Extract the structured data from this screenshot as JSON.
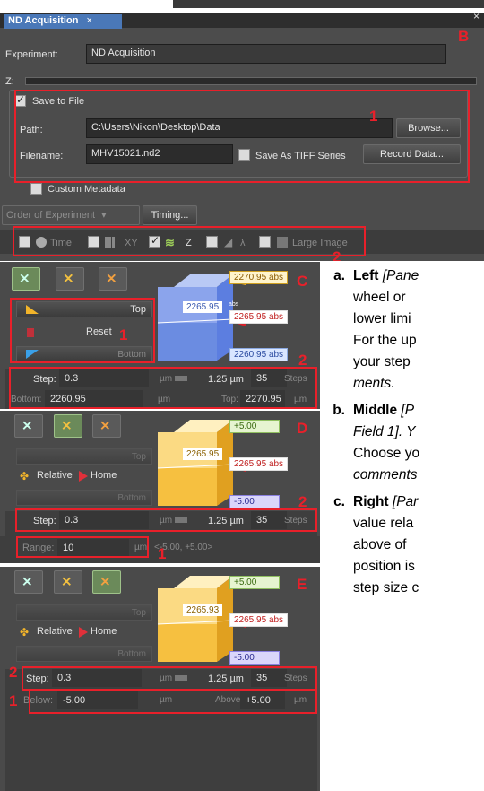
{
  "window": {
    "tab_label": "ND Acquisition",
    "tab_close": "×",
    "close_glyph": "×",
    "corner_letter": "B"
  },
  "experiment": {
    "label": "Experiment:",
    "value": "ND Acquisition"
  },
  "z_label": "Z:",
  "save": {
    "checkbox_label": "Save to File",
    "path_label": "Path:",
    "path_value": "C:\\Users\\Nikon\\Desktop\\Data",
    "browse_label": "Browse...",
    "filename_label": "Filename:",
    "filename_value": "MHV15021.nd2",
    "tiff_label": "Save As TIFF Series",
    "record_label": "Record Data..."
  },
  "custom_metadata_label": "Custom Metadata",
  "order_label": "Order of Experiment",
  "timing_label": "Timing...",
  "tabs": [
    {
      "label": "Time",
      "checked": false
    },
    {
      "label": "XY",
      "checked": false
    },
    {
      "label": "Z",
      "checked": true
    },
    {
      "label": "λ",
      "checked": false
    },
    {
      "label": "Large Image",
      "checked": false
    }
  ],
  "panel_c": {
    "letter": "C",
    "top_label": "Top",
    "reset_label": "Reset",
    "bottom_label": "Bottom",
    "top_value": "2270.95",
    "mid_value": "2265.95",
    "mid_left_value": "2265.95",
    "bottom_value": "2260.95",
    "abs_label": "abs",
    "abs_small": "abs",
    "step_label": "Step:",
    "step_value": "0.3",
    "unit": "µm",
    "step_um": "1.25 µm",
    "steps_count": "35",
    "steps_label": "Steps",
    "bottom_field_label": "Bottom:",
    "bottom_field_value": "2260.95",
    "top_field_label": "Top:",
    "top_field_value": "2270.95"
  },
  "panel_d": {
    "letter": "D",
    "top_label": "Top",
    "relative_label": "Relative",
    "home_label": "Home",
    "bottom_label": "Bottom",
    "plus_value": "+5.00",
    "mid_value": "2265.95",
    "mid_left_value": "2265.95",
    "minus_value": "-5.00",
    "abs_label": "abs",
    "step_label": "Step:",
    "step_value": "0.3",
    "unit": "µm",
    "step_um": "1.25 µm",
    "steps_count": "35",
    "steps_label": "Steps",
    "range_label": "Range:",
    "range_value": "10",
    "range_hint": "<-5.00, +5.00>"
  },
  "panel_e": {
    "letter": "E",
    "top_label": "Top",
    "relative_label": "Relative",
    "home_label": "Home",
    "bottom_label": "Bottom",
    "plus_value": "+5.00",
    "mid_value": "2265.95",
    "mid_left_value": "2265.93",
    "minus_value": "-5.00",
    "abs_label": "abs",
    "step_label": "Step:",
    "step_value": "0.3",
    "unit": "µm",
    "step_um": "1.25 µm",
    "steps_count": "35",
    "steps_label": "Steps",
    "below_label": "Below:",
    "below_value": "-5.00",
    "above_label": "Above:",
    "above_value": "+5.00"
  },
  "annotations": {
    "n1": "1",
    "n2": "2"
  },
  "doc_text": {
    "a_marker": "a.",
    "a_line1_bold": "Left",
    "a_line1_rest": " [Pane",
    "a_line2": "wheel or",
    "a_line3": "lower limi",
    "a_line4": "For the up",
    "a_line5": "your step",
    "a_line6": "ments.",
    "b_marker": "b.",
    "b_line1_bold": "Middle",
    "b_line1_rest": " [P",
    "b_line2": "Field 1]. Y",
    "b_line3": "Choose yo",
    "b_line4": "comments",
    "c_marker": "c.",
    "c_line1_bold": "Right",
    "c_line1_rest": " [Par",
    "c_line2": "value rela",
    "c_line3": "above of",
    "c_line4": "position is",
    "c_line5": "step size c"
  }
}
